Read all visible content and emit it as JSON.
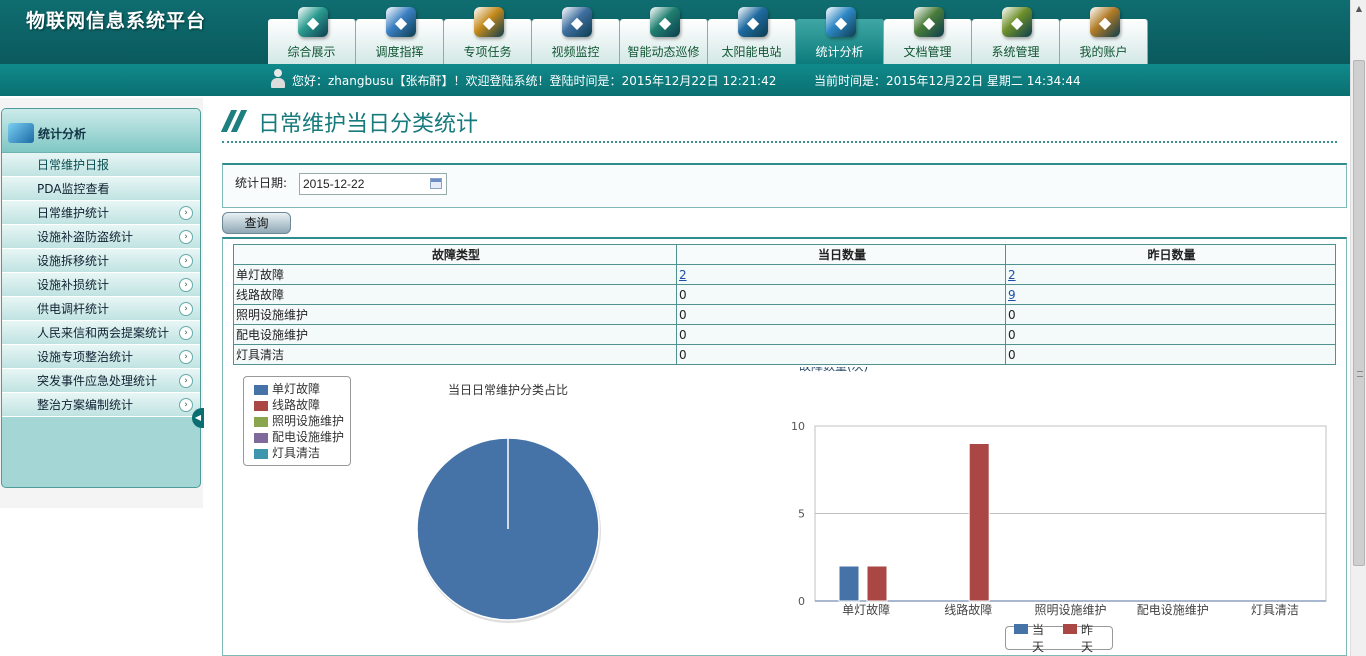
{
  "app": {
    "title": "物联网信息系统平台"
  },
  "nav": [
    {
      "label": "综合展示",
      "icon": "cube-chart-icon",
      "color": "#2a9b8f"
    },
    {
      "label": "调度指挥",
      "icon": "pen-wand-icon",
      "color": "#3a7fc1"
    },
    {
      "label": "专项任务",
      "icon": "star-book-icon",
      "color": "#c48a1b"
    },
    {
      "label": "视频监控",
      "icon": "monitor-icon",
      "color": "#3f6f9f"
    },
    {
      "label": "智能动态巡修",
      "icon": "globe-icon",
      "color": "#1f7f6f"
    },
    {
      "label": "太阳能电站",
      "icon": "solar-panel-icon",
      "color": "#1e6aa0"
    },
    {
      "label": "统计分析",
      "icon": "line-chart-icon",
      "color": "#2d87c4"
    },
    {
      "label": "文档管理",
      "icon": "gear-icon",
      "color": "#4a7d3a"
    },
    {
      "label": "系统管理",
      "icon": "atom-icon",
      "color": "#6d8f2a"
    },
    {
      "label": "我的账户",
      "icon": "user-lock-icon",
      "color": "#b07b26"
    }
  ],
  "nav_active_index": 6,
  "user": {
    "greeting": "您好：zhangbusu【张布酐】！欢迎登陆系统！登陆时间是：2015年12月22日 12:21:42",
    "current_time": "当前时间是：2015年12月22日 星期二  14:34:44"
  },
  "sidebar": {
    "title": "统计分析",
    "items": [
      {
        "label": "日常维护日报",
        "arrow": false
      },
      {
        "label": "PDA监控查看",
        "arrow": false
      },
      {
        "label": "日常维护统计",
        "arrow": true
      },
      {
        "label": "设施补盗防盗统计",
        "arrow": true
      },
      {
        "label": "设施拆移统计",
        "arrow": true
      },
      {
        "label": "设施补损统计",
        "arrow": true
      },
      {
        "label": "供电调杆统计",
        "arrow": true
      },
      {
        "label": "人民来信和两会提案统计",
        "arrow": true
      },
      {
        "label": "设施专项整治统计",
        "arrow": true
      },
      {
        "label": "突发事件应急处理统计",
        "arrow": true
      },
      {
        "label": "整治方案编制统计",
        "arrow": true
      }
    ]
  },
  "page": {
    "title": "日常维护当日分类统计"
  },
  "query": {
    "date_label": "统计日期:",
    "date_value": "2015-12-22",
    "button_label": "查询"
  },
  "table": {
    "headers": [
      "故障类型",
      "当日数量",
      "昨日数量"
    ],
    "rows": [
      {
        "type": "单灯故障",
        "today": "2",
        "yesterday": "2",
        "today_link": true,
        "yesterday_link": true
      },
      {
        "type": "线路故障",
        "today": "0",
        "yesterday": "9",
        "today_link": false,
        "yesterday_link": true
      },
      {
        "type": "照明设施维护",
        "today": "0",
        "yesterday": "0",
        "today_link": false,
        "yesterday_link": false
      },
      {
        "type": "配电设施维护",
        "today": "0",
        "yesterday": "0",
        "today_link": false,
        "yesterday_link": false
      },
      {
        "type": "灯具清洁",
        "today": "0",
        "yesterday": "0",
        "today_link": false,
        "yesterday_link": false
      }
    ]
  },
  "chart_data": [
    {
      "type": "pie",
      "title": "当日日常维护分类占比",
      "categories": [
        "单灯故障",
        "线路故障",
        "照明设施维护",
        "配电设施维护",
        "灯具清洁"
      ],
      "values": [
        2,
        0,
        0,
        0,
        0
      ],
      "colors": [
        "#4572a7",
        "#aa4643",
        "#89a54e",
        "#80699b",
        "#3d96ae"
      ],
      "legend": "top-left"
    },
    {
      "type": "bar",
      "ylabel": "故障数量(次)",
      "categories": [
        "单灯故障",
        "线路故障",
        "照明设施维护",
        "配电设施维护",
        "灯具清洁"
      ],
      "series": [
        {
          "name": "当天",
          "values": [
            2,
            0,
            0,
            0,
            0
          ],
          "color": "#4572a7"
        },
        {
          "name": "昨天",
          "values": [
            2,
            9,
            0,
            0,
            0
          ],
          "color": "#aa4643"
        }
      ],
      "ylim": [
        0,
        10
      ],
      "yticks": [
        0,
        5,
        10
      ],
      "grid": true,
      "legend": "bottom"
    }
  ]
}
